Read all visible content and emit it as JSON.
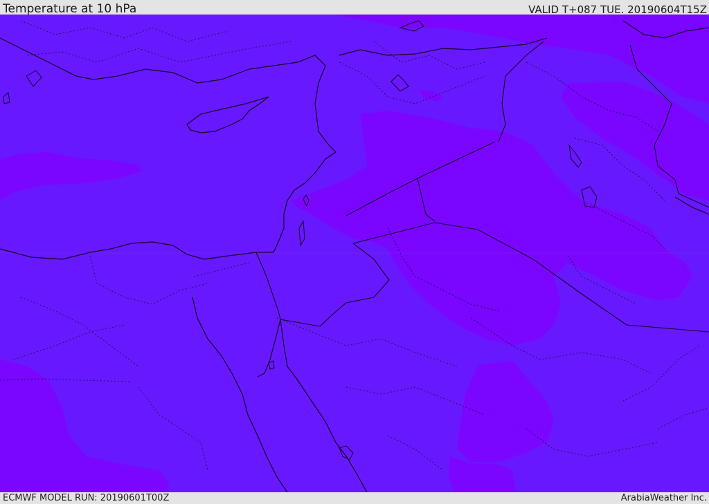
{
  "header": {
    "title": "Temperature at 10 hPa",
    "valid_time": "VALID T+087 TUE. 20190604T15Z"
  },
  "footer": {
    "model_run": "ECMWF MODEL RUN: 20190601T00Z",
    "credit": "ArabiaWeather Inc."
  },
  "map": {
    "field": "Temperature at 10 hPa",
    "colors": {
      "background_fill": "#6818ff",
      "warm_pocket_fill": "#7a06ff",
      "coastline": "#140726",
      "border": "#241050",
      "page_background": "#e4e4e4"
    },
    "features": [
      "filled-temperature-contours",
      "coastlines",
      "country-borders",
      "province-borders"
    ]
  }
}
